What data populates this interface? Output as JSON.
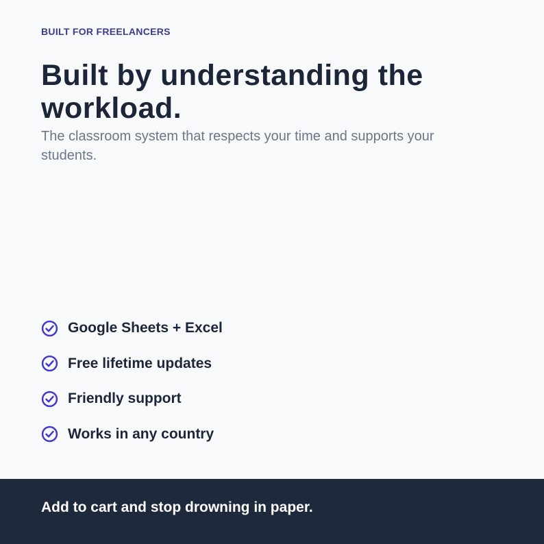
{
  "eyebrow": "BUILT FOR FREELANCERS",
  "headline": "Built by understanding the workload.",
  "subhead": "The classroom system that respects your time and supports your students.",
  "features": [
    {
      "label": "Google Sheets + Excel",
      "icon": "check-circle-icon"
    },
    {
      "label": "Free lifetime updates",
      "icon": "check-circle-icon"
    },
    {
      "label": "Friendly support",
      "icon": "check-circle-icon"
    },
    {
      "label": "Works in any country",
      "icon": "check-circle-icon"
    }
  ],
  "footer": {
    "cta": "Add to cart and stop drowning in paper."
  },
  "colors": {
    "accent": "#4338ca",
    "heading": "#1c2638",
    "muted": "#6b7686",
    "footer_bg": "#1e293b",
    "background": "#f8f9fb"
  }
}
